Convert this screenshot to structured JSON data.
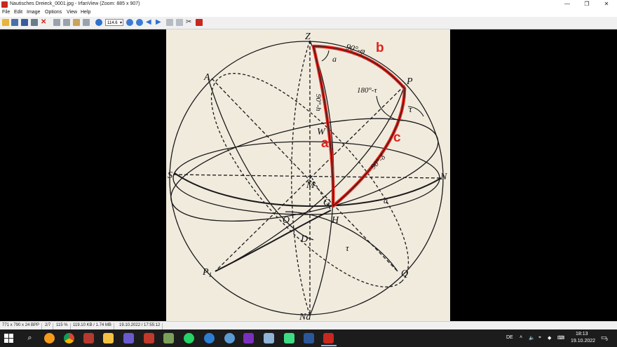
{
  "window": {
    "title": "Nautisches Dreieck_0001.jpg - IrfanView (Zoom: 885 x 907)",
    "minimize_glyph": "—",
    "maximize_glyph": "❐",
    "close_glyph": "✕"
  },
  "menu": {
    "items": [
      "File",
      "Edit",
      "Image",
      "Options",
      "View",
      "Help"
    ]
  },
  "toolbar": {
    "zoom_value": "114.6"
  },
  "diagram": {
    "labels": {
      "Z": "Z",
      "A": "A",
      "P": "P",
      "S": "S",
      "N": "N",
      "M": "M",
      "W": "W",
      "G": "G",
      "H": "H",
      "O": "O",
      "D": "D",
      "P1": "P",
      "P1_sub": "1",
      "Q": "Q",
      "Na": "Na",
      "alpha_top": "a",
      "alpha_right": "a",
      "tau_right": "τ",
      "tau_bottom": "τ",
      "arc_90_phi": "90°-φ",
      "arc_180_tau": "180°-τ",
      "arc_90_h": "90°-h",
      "arc_90_delta": "90°-δ"
    },
    "annotations": {
      "a": "a",
      "b": "b",
      "c": "c"
    },
    "annotation_color": "#e0231b"
  },
  "statusbar": {
    "dimensions": "771 x 790 x 24 BPP",
    "index": "2/7",
    "zoom": "115 %",
    "size": "119.10 KB / 1.74 MB",
    "datetime": "19.10.2022 / 17:55:12"
  },
  "taskbar": {
    "language": "DE",
    "time": "18:13",
    "date": "19.10.2022",
    "notification_count": "9"
  }
}
